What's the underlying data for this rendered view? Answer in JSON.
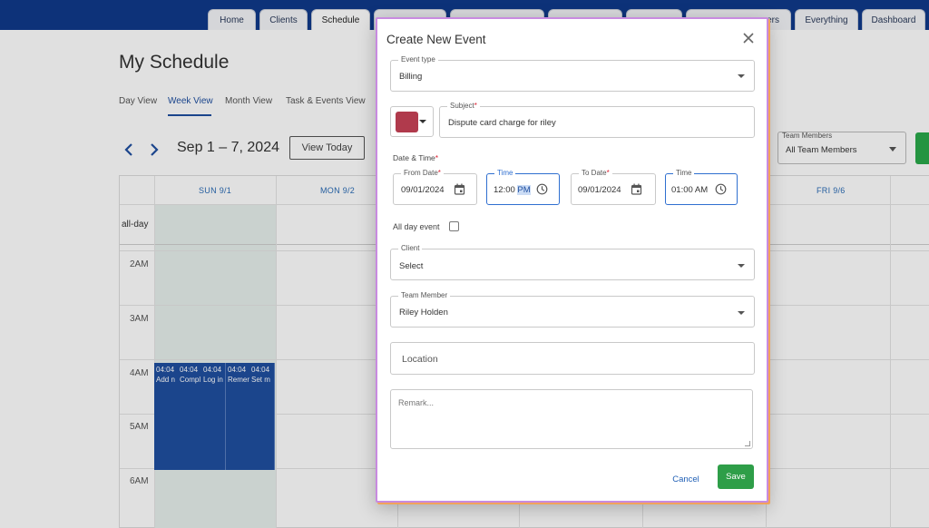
{
  "nav": {
    "tabs": [
      {
        "label": "Home"
      },
      {
        "label": "Clients"
      },
      {
        "label": "Schedule"
      },
      {
        "label": ""
      },
      {
        "label": ""
      },
      {
        "label": ""
      },
      {
        "label": ""
      },
      {
        "label": "ers"
      },
      {
        "label": "Everything"
      },
      {
        "label": "Dashboard"
      }
    ],
    "active": "Schedule"
  },
  "page": {
    "title": "My Schedule",
    "views": [
      "Day View",
      "Week View",
      "Month View",
      "Task & Events View"
    ],
    "active_view": "Week View",
    "date_range": "Sep 1 – 7, 2024",
    "view_today": "View Today",
    "team_filter": {
      "label": "Team Members",
      "value": "All Team Members"
    }
  },
  "calendar": {
    "days": [
      "SUN 9/1",
      "MON 9/2",
      "FRI 9/6"
    ],
    "allday_label": "all-day",
    "hours": [
      "2AM",
      "3AM",
      "4AM",
      "5AM",
      "6AM"
    ],
    "events": [
      {
        "time": "04:04",
        "title": "Add n"
      },
      {
        "time": "04:04",
        "title": "Compl"
      },
      {
        "time": "04:04",
        "title": "Log in"
      },
      {
        "time": "04:04",
        "title": "Remer"
      },
      {
        "time": "04:04",
        "title": "Set m"
      }
    ]
  },
  "modal": {
    "title": "Create New Event",
    "event_type": {
      "label": "Event type",
      "value": "Billing"
    },
    "color": "#b03a4c",
    "subject": {
      "label": "Subject",
      "value": "Dispute card charge for riley"
    },
    "date_time_label": "Date & Time",
    "from_date": {
      "label": "From Date",
      "value": "09/01/2024"
    },
    "from_time": {
      "label": "Time",
      "value_main": "12:00 ",
      "value_selected": "PM"
    },
    "to_date": {
      "label": "To Date",
      "value": "09/01/2024"
    },
    "to_time": {
      "label": "Time",
      "value": "01:00 AM"
    },
    "all_day_label": "All day event",
    "all_day_checked": false,
    "client": {
      "label": "Client",
      "value": "Select"
    },
    "team_member": {
      "label": "Team Member",
      "value": "Riley Holden"
    },
    "location_placeholder": "Location",
    "remark_placeholder": "Remark...",
    "cancel_label": "Cancel",
    "save_label": "Save",
    "required_mark": "*"
  }
}
